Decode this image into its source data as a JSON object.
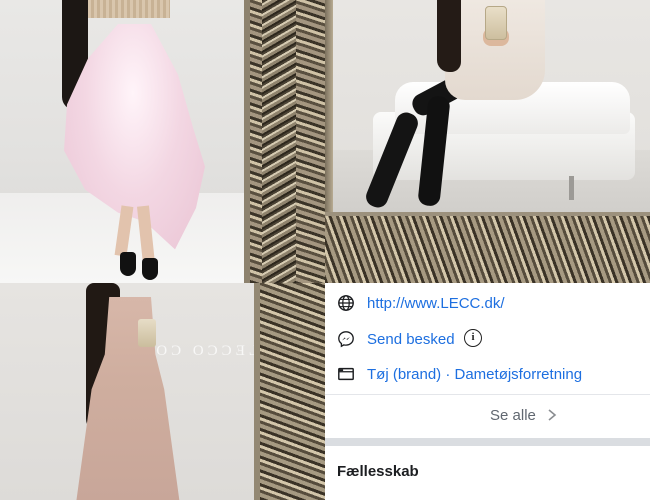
{
  "photos": {
    "photo3_wall_text": "LECCO COUTURE"
  },
  "info": {
    "website": "http://www.LECC.dk/",
    "message_label": "Send besked",
    "info_glyph": "i",
    "category": "Tøj (brand) · Dametøjsforretning",
    "see_all": "Se alle",
    "community_heading": "Fællesskab"
  },
  "icons": {
    "website": "globe-icon",
    "message": "messenger-icon",
    "category": "folder-icon",
    "info": "info-icon",
    "see_all": "chevron-right-icon"
  },
  "colors": {
    "link": "#1d6fe0",
    "muted": "#606770",
    "divider": "#e4e6ea",
    "band": "#dadde1"
  }
}
